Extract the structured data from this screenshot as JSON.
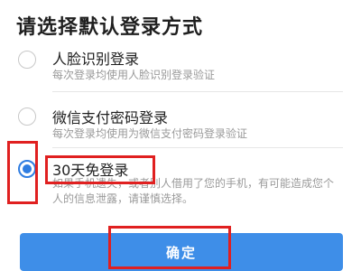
{
  "header": {
    "title": "请选择默认登录方式"
  },
  "options": [
    {
      "label": "人脸识别登录",
      "description": "每次登录均使用人脸识别登录验证",
      "selected": false
    },
    {
      "label": "微信支付密码登录",
      "description": "每次登录均使用为微信支付密码登录验证",
      "selected": false
    },
    {
      "label": "30天免登录",
      "description": "如果手机遗失，或者别人借用了您的手机，有可能造成您个人的信息泄露，请谨慎选择。",
      "selected": true
    }
  ],
  "footer": {
    "confirm_label": "确定"
  },
  "colors": {
    "accent": "#3e8ee8",
    "annotation": "#e02020"
  }
}
